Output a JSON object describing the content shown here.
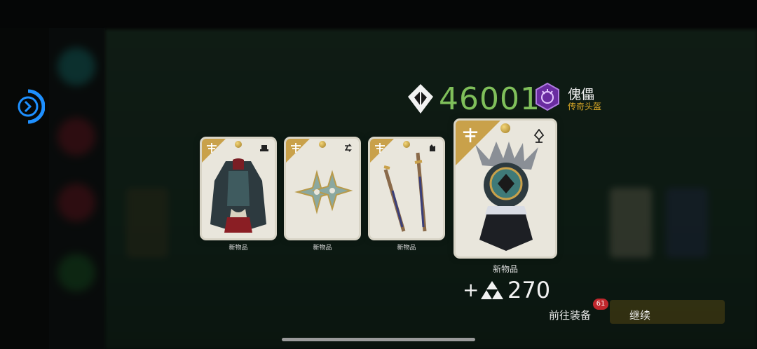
{
  "score": {
    "value": "46001",
    "color": "#7fbf5a",
    "icon": "diamond-icon"
  },
  "reward_item": {
    "name": "傀儡",
    "rarity": "传奇头盔",
    "rarity_color": "#d9a827",
    "badge_icon": "legendary-helmet-badge-icon"
  },
  "cards": [
    {
      "caption": "新物品",
      "art": "chest-armor",
      "type_icon": "hat-icon"
    },
    {
      "caption": "新物品",
      "art": "shuriken",
      "type_icon": "arrows-icon"
    },
    {
      "caption": "新物品",
      "art": "dual-swords",
      "type_icon": "fist-icon"
    },
    {
      "caption": "新物品",
      "art": "helmet",
      "type_icon": "pin-icon"
    }
  ],
  "bonus": {
    "sign": "+",
    "value": "270",
    "icon": "triforce-icon"
  },
  "actions": {
    "equip_label": "前往装备",
    "equip_badge": "61",
    "continue_label": "继续"
  },
  "colors": {
    "card_gold": "#c9a14a",
    "accent_blue": "#1e90ff"
  }
}
